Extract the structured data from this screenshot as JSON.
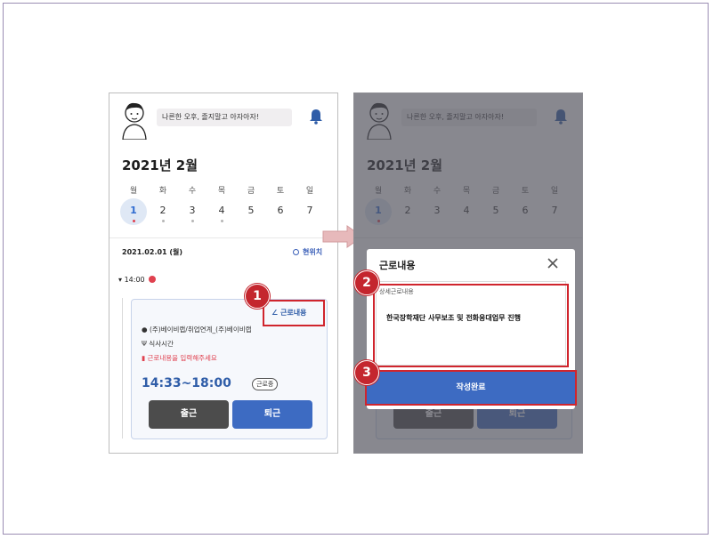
{
  "greeting": "나른한 오후, 졸지말고 아자아자!",
  "month_title": "2021년 2월",
  "weekdays": [
    "월",
    "화",
    "수",
    "목",
    "금",
    "토",
    "일"
  ],
  "days": [
    "1",
    "2",
    "3",
    "4",
    "5",
    "6",
    "7"
  ],
  "selected_date": "2021.02.01 (월)",
  "location_link": "현위치",
  "time_slot": "14:00",
  "edit_link": "근로내용",
  "card": {
    "workplace": "(주)베이비랩/취업연계_(주)베이비랩",
    "break": "식사시간",
    "warning": "근로내용을 입력해주세요",
    "time_range": "14:33~18:00",
    "status_chip": "근로중",
    "checkin_label": "출근",
    "checkout_label": "퇴근"
  },
  "modal": {
    "title": "근로내용",
    "field_label": "상세근로내용",
    "field_value": "한국장학재단 사무보조 및 전화응대업무 진행",
    "submit_label": "작성완료"
  },
  "callouts": [
    "1",
    "2",
    "3"
  ],
  "colors": {
    "accent": "#3d6bc2",
    "callout": "#c4262e",
    "warning": "#e0414f"
  }
}
